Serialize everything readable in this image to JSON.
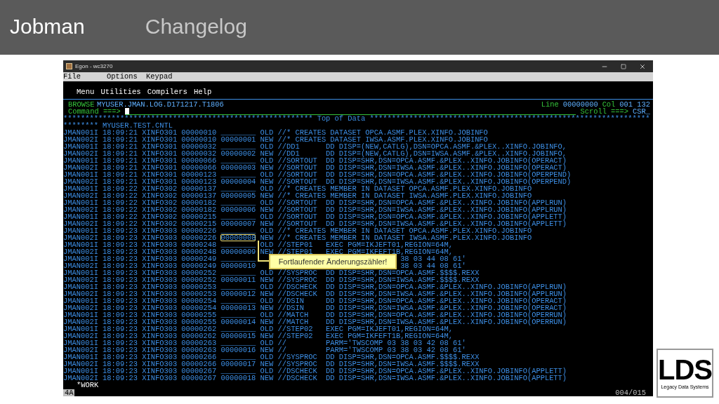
{
  "slide": {
    "title": "Jobman",
    "subtitle": "Changelog"
  },
  "window": {
    "title": "Egon - wc3270",
    "menu": [
      "File",
      "Options",
      "Keypad"
    ]
  },
  "terminal": {
    "menu": [
      "Menu",
      "Utilities",
      "Compilers",
      "Help"
    ],
    "mode": "BROWSE",
    "dataset": "MYUSER.JMAN.LOG.D171217.T1806",
    "line_label": "Line",
    "line": "00000000",
    "col_label": "Col",
    "col": "001 132",
    "command_label": "Command ===>",
    "scroll_label": "Scroll ===>",
    "scroll": "CSR_",
    "top_of_data": "********************************************************* Top of Data ****************************************************************",
    "header": "******** MYUSER.TEST.CNTL",
    "rows": [
      {
        "kind": "line",
        "text": "JMAN001I 18:09:21 XINFO301 00000010 ________ OLD //* CREATES DATASET OPCA.ASMF.PLEX.XINFO.JOBINFO"
      },
      {
        "kind": "line",
        "text": "JMAN002I 18:09:21 XINFO301 00000010 00000001 NEW //* CREATES DATASET IWSA.ASMF.PLEX.XINFO.JOBINFO"
      },
      {
        "kind": "line",
        "text": "JMAN001I 18:09:21 XINFO301 00000032 ________ OLD //DD1      DD DISP=(NEW,CATLG),DSN=OPCA.ASMF.&PLEX..XINFO.JOBINFO,"
      },
      {
        "kind": "line",
        "text": "JMAN002I 18:09:21 XINFO301 00000032 00000002 NEW //DD1      DD DISP=(NEW,CATLG),DSN=IWSA.ASMF.&PLEX..XINFO.JOBINFO,"
      },
      {
        "kind": "line",
        "text": "JMAN001I 18:09:21 XINFO301 00000066 ________ OLD //SORTOUT  DD DISP=SHR,DSN=OPCA.ASMF.&PLEX..XINFO.JOBINFO(OPERACT)"
      },
      {
        "kind": "line",
        "text": "JMAN002I 18:09:21 XINFO301 00000066 00000003 NEW //SORTOUT  DD DISP=SHR,DSN=IWSA.ASMF.&PLEX..XINFO.JOBINFO(OPERACT)"
      },
      {
        "kind": "line",
        "text": "JMAN001I 18:09:21 XINFO301 00000123 ________ OLD //SORTOUT  DD DISP=SHR,DSN=OPCA.ASMF.&PLEX..XINFO.JOBINFO(OPERPEND)"
      },
      {
        "kind": "line",
        "text": "JMAN002I 18:09:21 XINFO301 00000123 00000004 NEW //SORTOUT  DD DISP=SHR,DSN=IWSA.ASMF.&PLEX..XINFO.JOBINFO(OPERPEND)"
      },
      {
        "kind": "line",
        "text": "JMAN001I 18:09:22 XINFO302 00000137 ________ OLD //* CREATES MEMBER IN DATASET OPCA.ASMF.PLEX.XINFO.JOBINFO"
      },
      {
        "kind": "line",
        "text": "JMAN002I 18:09:22 XINFO302 00000137 00000005 NEW //* CREATES MEMBER IN DATASET IWSA.ASMF.PLEX.XINFO.JOBINFO"
      },
      {
        "kind": "line",
        "text": "JMAN001I 18:09:22 XINFO302 00000182 ________ OLD //SORTOUT  DD DISP=SHR,DSN=OPCA.ASMF.&PLEX..XINFO.JOBINFO(APPLRUN)"
      },
      {
        "kind": "line",
        "text": "JMAN002I 18:09:22 XINFO302 00000182 00000006 NEW //SORTOUT  DD DISP=SHR,DSN=IWSA.ASMF.&PLEX..XINFO.JOBINFO(APPLRUN)"
      },
      {
        "kind": "line",
        "text": "JMAN001I 18:09:22 XINFO302 00000215 ________ OLD //SORTOUT  DD DISP=SHR,DSN=OPCA.ASMF.&PLEX..XINFO.JOBINFO(APPLETT)"
      },
      {
        "kind": "line",
        "text": "JMAN002I 18:09:22 XINFO302 00000215 00000007 NEW //SORTOUT  DD DISP=SHR,DSN=IWSA.ASMF.&PLEX..XINFO.JOBINFO(APPLETT)"
      },
      {
        "kind": "line",
        "text": "JMAN001I 18:09:23 XINFO303 00000226 ________ OLD //* CREATES MEMBER IN DATASET OPCA.ASMF.PLEX.XINFO.JOBINFO"
      },
      {
        "kind": "marked",
        "text": "JMAN002I 18:09:23 XINFO303 00000226 ",
        "marked": "00000008",
        "rest": " NEW //* CREATES MEMBER IN DATASET IWSA.ASMF.PLEX.XINFO.JOBINFO"
      },
      {
        "kind": "line",
        "text": "JMAN001I 18:09:23 XINFO303 00000248 ________ OLD //STEP01   EXEC PGM=IKJEFT01,REGION=64M,"
      },
      {
        "kind": "line",
        "text": "JMAN002I 18:09:23 XINFO303 00000248 00000009 NEW //STEP01   EXEC PGM=IKFEFT1B,REGION=64M,"
      },
      {
        "kind": "covered",
        "text": "JMAN001I 18:09:23 XINFO303 00000249 ________",
        "tail": "38 03 44 08 61'"
      },
      {
        "kind": "covered",
        "text": "JMAN002I 18:09:23 XINFO303 00000249 00000010",
        "tail": "38 03 44 08 61'"
      },
      {
        "kind": "line",
        "text": "JMAN001I 18:09:23 XINFO303 00000252 ________ OLD //SYSPROC  DD DISP=SHR,DSN=OPCA.ASMF.$$$$.REXX"
      },
      {
        "kind": "line",
        "text": "JMAN002I 18:09:23 XINFO303 00000252 00000011 NEW //SYSPROC  DD DISP=SHR,DSN=IWSA.ASMF.$$$$.REXX"
      },
      {
        "kind": "line",
        "text": "JMAN001I 18:09:23 XINFO303 00000253 ________ OLD //DSCHECK  DD DISP=SHR,DSN=OPCA.ASMF.&PLEX..XINFO.JOBINFO(APPLRUN)"
      },
      {
        "kind": "line",
        "text": "JMAN002I 18:09:23 XINFO303 00000253 00000012 NEW //DSCHECK  DD DISP=SHR,DSN=IWSA.ASMF.&PLEX..XINFO.JOBINFO(APPLRUN)"
      },
      {
        "kind": "line",
        "text": "JMAN001I 18:09:23 XINFO303 00000254 ________ OLD //DSIN     DD DISP=SHR,DSN=OPCA.ASMF.&PLEX..XINFO.JOBINFO(OPERACT)"
      },
      {
        "kind": "line",
        "text": "JMAN002I 18:09:23 XINFO303 00000254 00000013 NEW //DSIN     DD DISP=SHR,DSN=IWSA.ASMF.&PLEX..XINFO.JOBINFO(OPERACT)"
      },
      {
        "kind": "line",
        "text": "JMAN001I 18:09:23 XINFO303 00000255 ________ OLD //MATCH    DD DISP=SHR,DSN=OPCA.ASMF.&PLEX..XINFO.JOBINFO(OPERRUN)"
      },
      {
        "kind": "line",
        "text": "JMAN002I 18:09:23 XINFO303 00000255 00000014 NEW //MATCH    DD DISP=SHR,DSN=IWSA.ASMF.&PLEX..XINFO.JOBINFO(OPERRUN)"
      },
      {
        "kind": "line",
        "text": "JMAN001I 18:09:23 XINFO303 00000262 ________ OLD //STEP02   EXEC PGM=IKJEFT01,REGION=64M,"
      },
      {
        "kind": "line",
        "text": "JMAN002I 18:09:23 XINFO303 00000262 00000015 NEW //STEP02   EXEC PGM=IKFEFT1B,REGION=64M,"
      },
      {
        "kind": "line",
        "text": "JMAN001I 18:09:23 XINFO303 00000263 ________ OLD //         PARM='TWSCOMP 03 38 03 42 08 61'"
      },
      {
        "kind": "line",
        "text": "JMAN002I 18:09:23 XINFO303 00000263 00000016 NEW //         PARM='TWSCOMP 03 38 03 42 08 61'"
      },
      {
        "kind": "line",
        "text": "JMAN001I 18:09:23 XINFO303 00000266 ________ OLD //SYSPROC  DD DISP=SHR,DSN=OPCA.ASMF.$$$$.REXX"
      },
      {
        "kind": "line",
        "text": "JMAN002I 18:09:23 XINFO303 00000266 00000017 NEW //SYSPROC  DD DISP=SHR,DSN=IWSA.ASMF.$$$$.REXX"
      },
      {
        "kind": "line",
        "text": "JMAN001I 18:09:23 XINFO303 00000267 ________ OLD //DSCHECK  DD DISP=SHR,DSN=OPCA.ASMF.&PLEX..XINFO.JOBINFO(APPLETT)"
      },
      {
        "kind": "line",
        "text": "JMAN002I 18:09:23 XINFO303 00000267 00000018 NEW //DSCHECK  DD DISP=SHR,DSN=IWSA.ASMF.&PLEX..XINFO.JOBINFO(APPLETT)"
      }
    ],
    "footer_line": "*WORK",
    "status": {
      "left": "4A",
      "right": "004/015"
    }
  },
  "callout": {
    "text": "Fortlaufender Änderungszähler!"
  },
  "logo": {
    "mark": "LDS",
    "caption": "Legacy Data Systems"
  }
}
